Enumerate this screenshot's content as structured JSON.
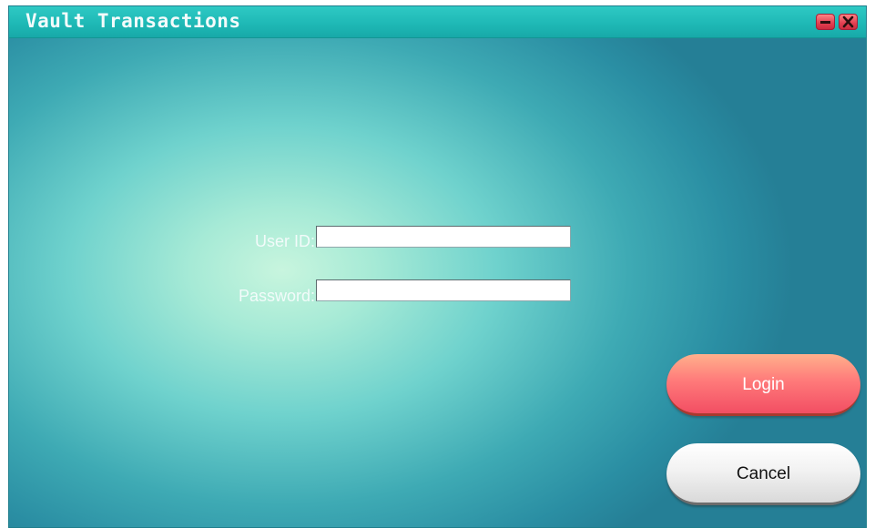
{
  "window": {
    "title": "Vault Transactions",
    "minimize_icon": "minimize-icon",
    "close_icon": "close-icon",
    "control_color": "#e23e50",
    "background_center_color": "#c8f5de",
    "background_edge_color": "#257f96"
  },
  "login_form": {
    "user_id_label": "User ID:",
    "user_id_value": "",
    "password_label": "Password:",
    "password_value": ""
  },
  "buttons": {
    "login_label": "Login",
    "login_color": "#f24e63",
    "cancel_label": "Cancel",
    "cancel_color": "#e0e0e0"
  }
}
